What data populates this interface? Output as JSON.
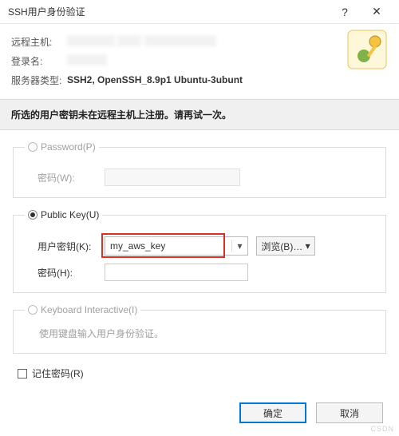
{
  "title": "SSH用户身份验证",
  "help_glyph": "?",
  "close_glyph": "✕",
  "info": {
    "remote_host_label": "远程主机:",
    "login_label": "登录名:",
    "server_type_label": "服务器类型:",
    "server_type_value": "SSH2, OpenSSH_8.9p1 Ubuntu-3ubunt"
  },
  "warning": "所选的用户密钥未在远程主机上注册。请再试一次。",
  "sections": {
    "password": {
      "radio_label": "Password(P)",
      "pw_label": "密码(W):"
    },
    "publickey": {
      "radio_label": "Public Key(U)",
      "userkey_label": "用户密钥(K):",
      "key_value": "my_aws_key",
      "browse_label": "浏览(B)…",
      "dropdown_glyph": "▾",
      "pw_label": "密码(H):"
    },
    "keyboard": {
      "radio_label": "Keyboard Interactive(I)",
      "hint": "使用键盘输入用户身份验证。"
    }
  },
  "remember_label": "记住密码(R)",
  "ok_label": "确定",
  "cancel_label": "取消"
}
